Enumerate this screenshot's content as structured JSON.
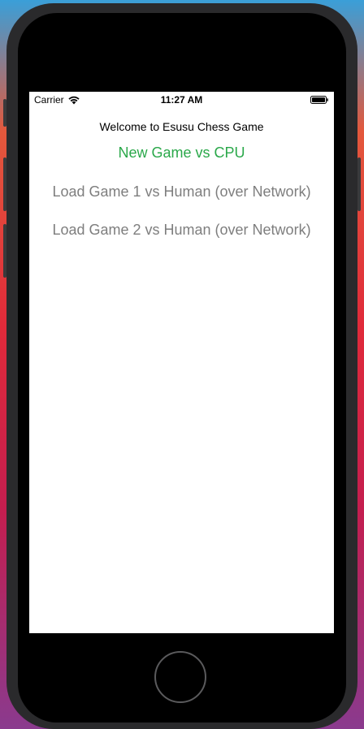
{
  "status_bar": {
    "carrier": "Carrier",
    "time": "11:27 AM"
  },
  "main": {
    "welcome": "Welcome to Esusu Chess Game",
    "buttons": [
      {
        "label": "New Game vs CPU",
        "color": "#2aa84a"
      },
      {
        "label": "Load Game 1 vs Human (over Network)",
        "color": "#7e7e7e"
      },
      {
        "label": "Load Game 2 vs Human (over Network)",
        "color": "#7e7e7e"
      }
    ]
  },
  "icons": {
    "wifi": "wifi-icon",
    "battery": "battery-icon",
    "home": "home-button"
  }
}
